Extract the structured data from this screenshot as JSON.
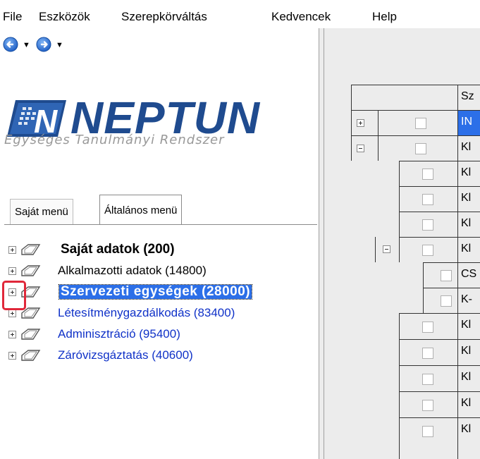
{
  "menubar": {
    "items": [
      "File",
      "Eszközök",
      "Szerepkörváltás",
      "Kedvencek",
      "Help"
    ]
  },
  "logo": {
    "title": "NEPTUN",
    "subtitle": "Egységes Tanulmányi Rendszer",
    "color": "#1f4b8f"
  },
  "tabs": [
    {
      "label": "Saját menü",
      "active": false
    },
    {
      "label": "Általános menü",
      "active": true
    }
  ],
  "tree": [
    {
      "label": "Saját adatok (200)",
      "style": "bold"
    },
    {
      "label": "Alkalmazotti adatok (14800)",
      "style": "plain"
    },
    {
      "label": "Szervezeti egységek (28000)",
      "style": "selected"
    },
    {
      "label": "Létesítménygazdálkodás (83400)",
      "style": "link"
    },
    {
      "label": "Adminisztráció (95400)",
      "style": "link"
    },
    {
      "label": "Záróvizsgáztatás (40600)",
      "style": "link"
    }
  ],
  "grid": {
    "header": "Sz",
    "rows": [
      "IN",
      "Kl",
      "Kl",
      "Kl",
      "Kl",
      "Kl",
      "CS",
      "K-",
      "Kl",
      "Kl",
      "Kl",
      "Kl",
      "Kl"
    ]
  },
  "colors": {
    "selection": "#2c6fe8",
    "link": "#1032c8",
    "highlight": "#e0283a"
  }
}
